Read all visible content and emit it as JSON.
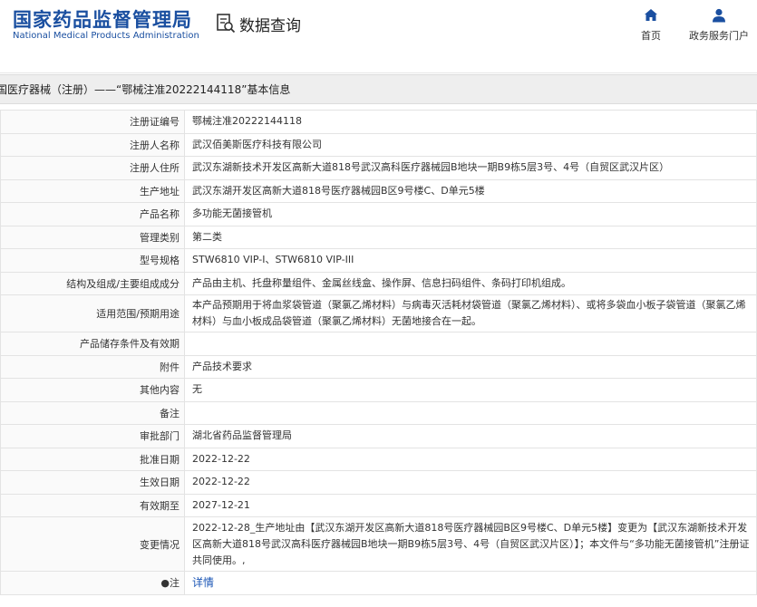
{
  "header": {
    "logo_cn": "国家药品监督管理局",
    "logo_en": "National Medical Products Administration",
    "data_query": "数据查询",
    "nav": [
      {
        "label": "首页",
        "icon": "home-icon"
      },
      {
        "label": "政务服务门户",
        "icon": "user-icon"
      }
    ],
    "brand_color": "#1a4fa0"
  },
  "title_bar": "国医疗器械（注册）——“鄂械注准20222144118”基本信息",
  "rows": [
    {
      "label": "注册证编号",
      "value": "鄂械注准20222144118"
    },
    {
      "label": "注册人名称",
      "value": "武汉佰美斯医疗科技有限公司"
    },
    {
      "label": "注册人住所",
      "value": "武汉东湖新技术开发区高新大道818号武汉高科医疗器械园B地块一期B9栋5层3号、4号（自贸区武汉片区）"
    },
    {
      "label": "生产地址",
      "value": "武汉东湖开发区高新大道818号医疗器械园B区9号楼C、D单元5楼"
    },
    {
      "label": "产品名称",
      "value": "多功能无菌接管机"
    },
    {
      "label": "管理类别",
      "value": "第二类"
    },
    {
      "label": "型号规格",
      "value": "STW6810 VIP-I、STW6810 VIP-III"
    },
    {
      "label": "结构及组成/主要组成成分",
      "value": "产品由主机、托盘称量组件、金属丝线盒、操作屏、信息扫码组件、条码打印机组成。"
    },
    {
      "label": "适用范围/预期用途",
      "value": "本产品预期用于将血浆袋管道（聚氯乙烯材料）与病毒灭活耗材袋管道（聚氯乙烯材料）、或将多袋血小板子袋管道（聚氯乙烯材料）与血小板成品袋管道（聚氯乙烯材料）无菌地接合在一起。"
    },
    {
      "label": "产品储存条件及有效期",
      "value": ""
    },
    {
      "label": "附件",
      "value": "产品技术要求"
    },
    {
      "label": "其他内容",
      "value": "无"
    },
    {
      "label": "备注",
      "value": ""
    },
    {
      "label": "审批部门",
      "value": "湖北省药品监督管理局"
    },
    {
      "label": "批准日期",
      "value": "2022-12-22"
    },
    {
      "label": "生效日期",
      "value": "2022-12-22"
    },
    {
      "label": "有效期至",
      "value": "2027-12-21"
    },
    {
      "label": "变更情况",
      "value": "2022-12-28_生产地址由【武汉东湖开发区高新大道818号医疗器械园B区9号楼C、D单元5楼】变更为【武汉东湖新技术开发区高新大道818号武汉高科医疗器械园B地块一期B9栋5层3号、4号（自贸区武汉片区）】；本文件与“多功能无菌接管机”注册证共同使用。,"
    },
    {
      "label": "●注",
      "value": "详情"
    }
  ]
}
